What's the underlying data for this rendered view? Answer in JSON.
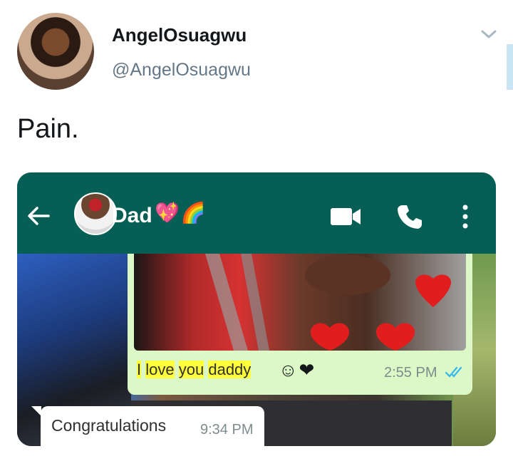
{
  "tweet": {
    "display_name": "AngelOsuagwu",
    "handle": "@AngelOsuagwu",
    "text": "Pain."
  },
  "whatsapp": {
    "contact_name": "Dad",
    "contact_emojis": "💖🌈",
    "messages": {
      "outgoing": {
        "segments": [
          "I",
          "love",
          "you",
          "daddy"
        ],
        "emojis": "☺❤",
        "time": "2:55 PM"
      },
      "incoming": {
        "text": "Congratulations",
        "time": "9:34 PM"
      }
    }
  },
  "icons": {
    "chevron": "chevron-down-icon",
    "back": "back-arrow-icon",
    "video": "video-call-icon",
    "phone": "phone-call-icon",
    "menu": "kebab-menu-icon",
    "read": "double-check-icon"
  },
  "colors": {
    "whatsapp_header": "#075e54",
    "outgoing_bubble": "#dcf8c6",
    "read_ticks": "#34b7f1",
    "highlight": "#ffff3b"
  }
}
